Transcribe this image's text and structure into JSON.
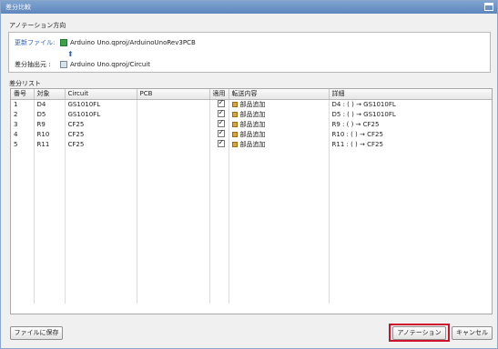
{
  "window": {
    "title": "差分比較"
  },
  "annotation": {
    "section_title": "アノテーション方向",
    "update_file_label": "更新ファイル:",
    "update_file_value": "Arduino Uno.qproj/ArduinoUnoRev3PCB",
    "source_label": "差分抽出元 :",
    "source_value": "Arduino Uno.qproj/Circuit"
  },
  "diff_list": {
    "section_title": "差分リスト",
    "columns": [
      "番号",
      "対象",
      "Circuit",
      "PCB",
      "適用",
      "転送内容",
      "詳細"
    ],
    "rows": [
      {
        "no": "1",
        "target": "D4",
        "circuit": "GS1010FL",
        "pcb": "",
        "apply": true,
        "transfer": "部品追加",
        "detail": "D4 : ( ) → GS1010FL"
      },
      {
        "no": "2",
        "target": "D5",
        "circuit": "GS1010FL",
        "pcb": "",
        "apply": true,
        "transfer": "部品追加",
        "detail": "D5 : ( ) → GS1010FL"
      },
      {
        "no": "3",
        "target": "R9",
        "circuit": "CF25",
        "pcb": "",
        "apply": true,
        "transfer": "部品追加",
        "detail": "R9 : ( ) → CF25"
      },
      {
        "no": "4",
        "target": "R10",
        "circuit": "CF25",
        "pcb": "",
        "apply": true,
        "transfer": "部品追加",
        "detail": "R10 : ( ) → CF25"
      },
      {
        "no": "5",
        "target": "R11",
        "circuit": "CF25",
        "pcb": "",
        "apply": true,
        "transfer": "部品追加",
        "detail": "R11 : ( ) → CF25"
      }
    ]
  },
  "buttons": {
    "save_to_file": "ファイルに保存",
    "annotation": "アノテーション",
    "cancel": "キャンセル"
  },
  "colors": {
    "titlebar": "#5d86bd",
    "highlight": "#d0112b"
  }
}
